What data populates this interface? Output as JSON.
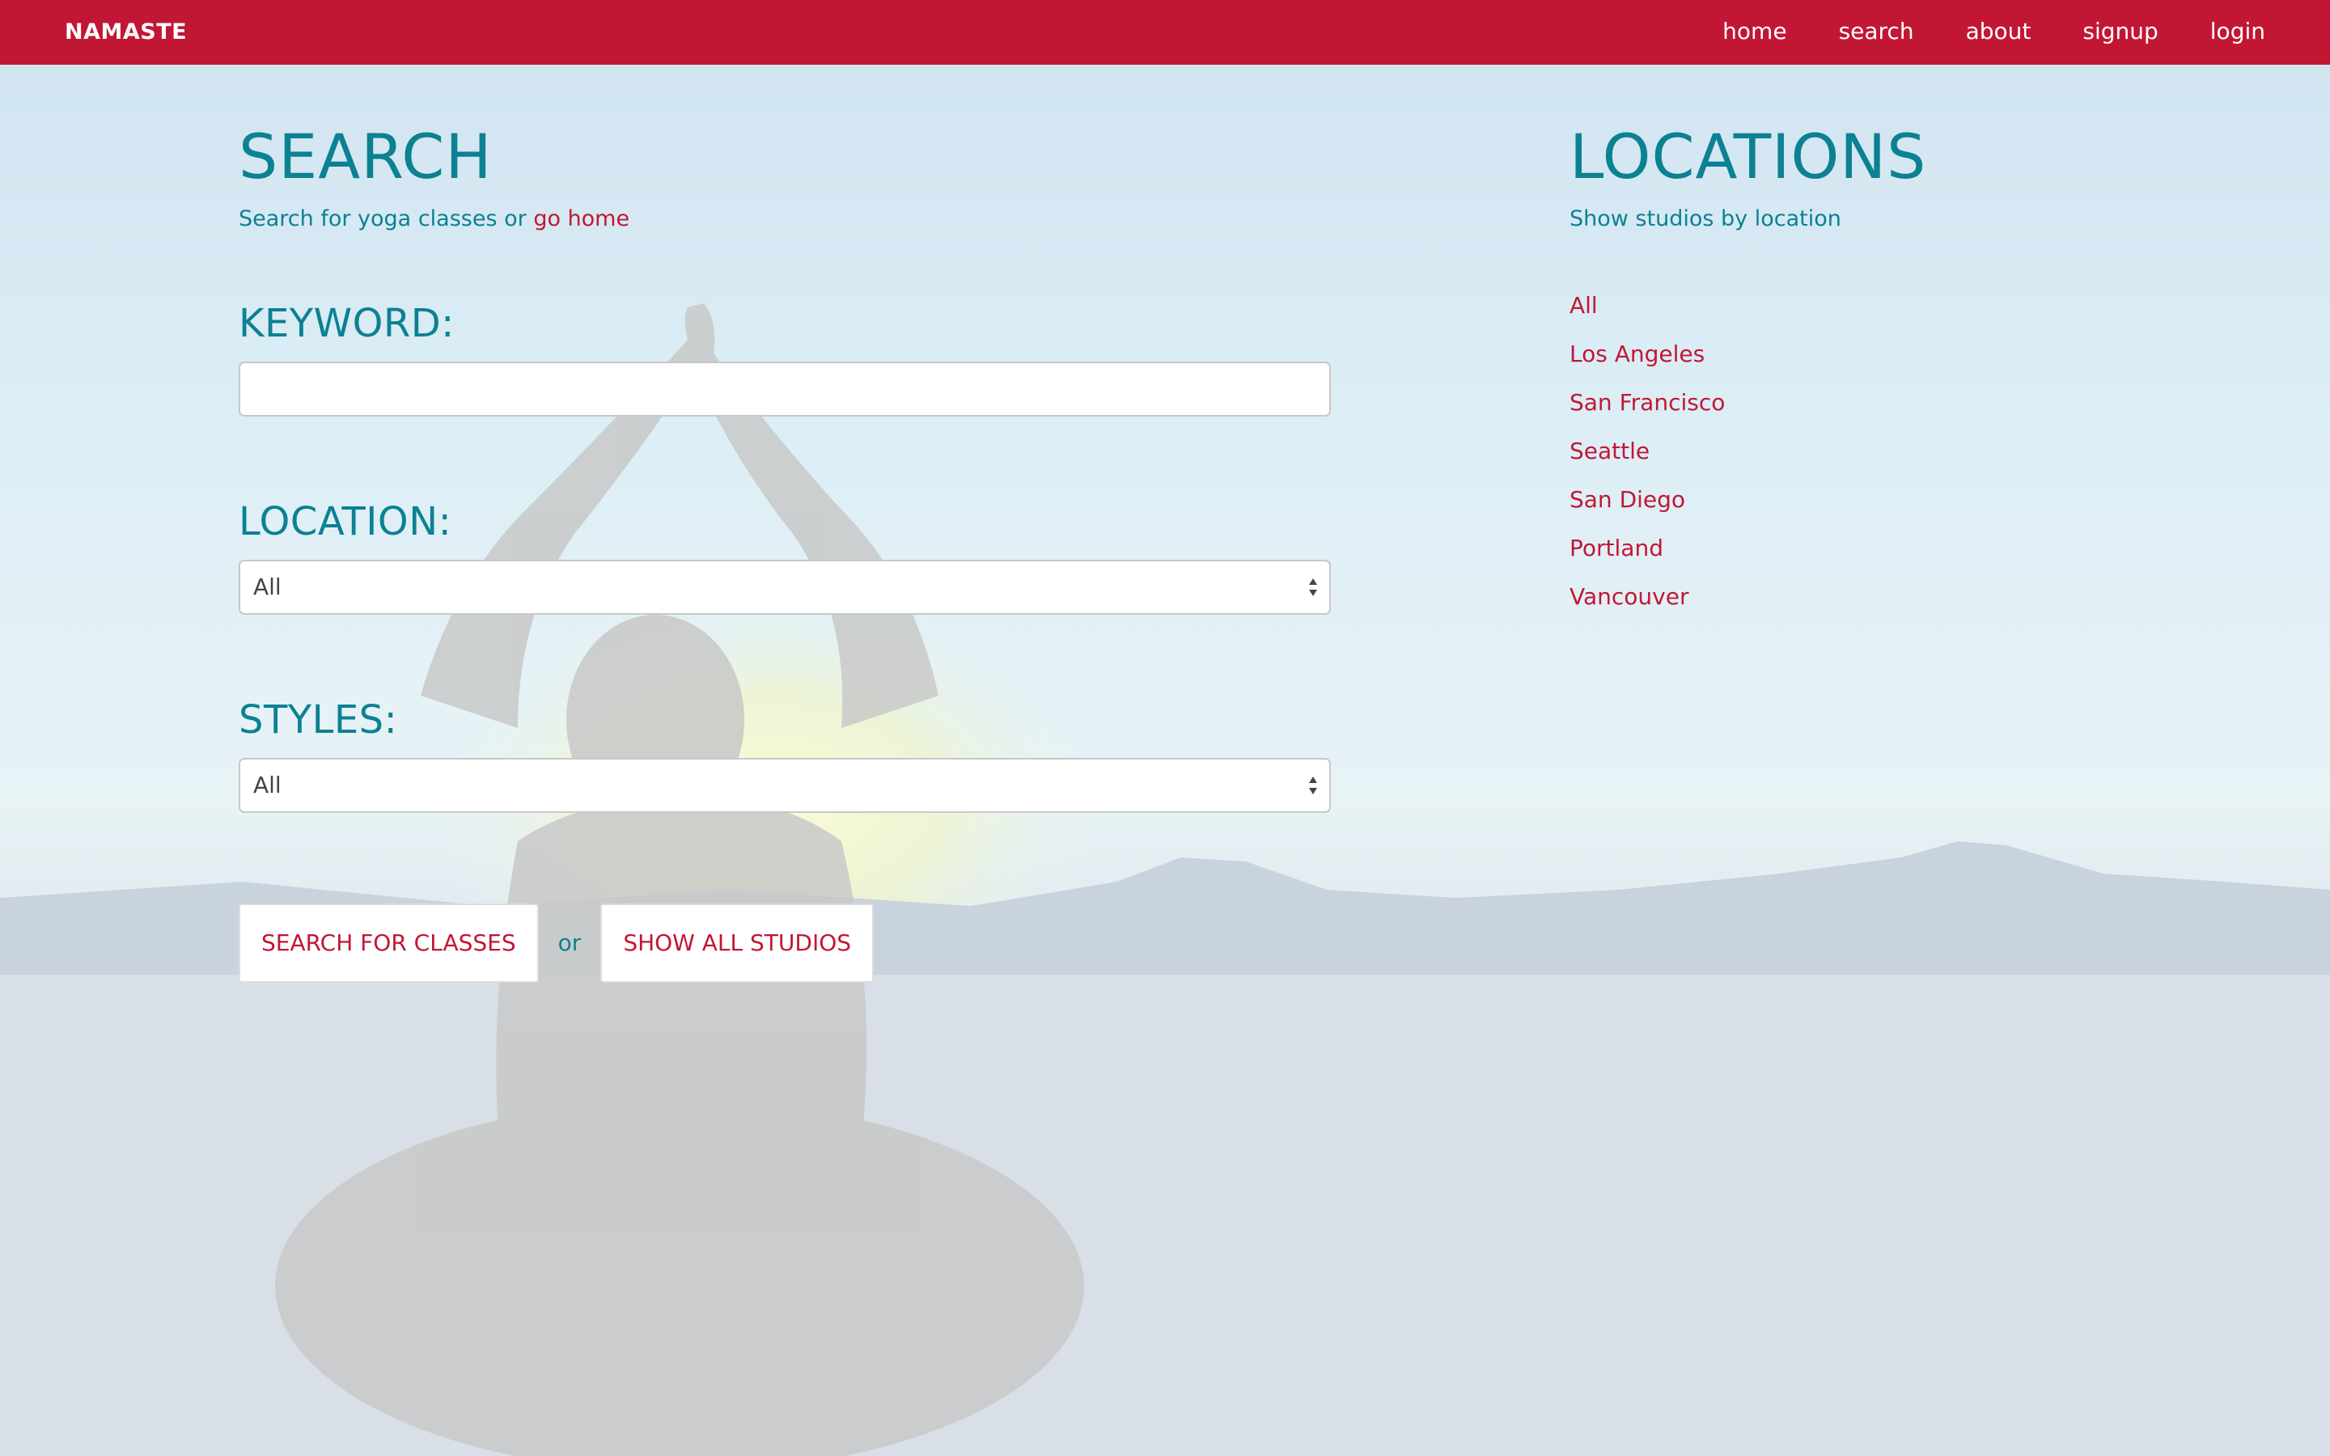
{
  "navbar": {
    "brand": "NAMASTE",
    "links": [
      "home",
      "search",
      "about",
      "signup",
      "login"
    ]
  },
  "search": {
    "title": "SEARCH",
    "subtitle_text": "Search for yoga classes or ",
    "subtitle_link": "go home",
    "keyword_label": "KEYWORD:",
    "keyword_value": "",
    "location_label": "LOCATION:",
    "location_selected": "All",
    "styles_label": "STYLES:",
    "styles_selected": "All",
    "search_button": "SEARCH FOR CLASSES",
    "or_text": "or",
    "show_all_button": "SHOW ALL STUDIOS"
  },
  "locations": {
    "title": "LOCATIONS",
    "subtitle": "Show studios by location",
    "items": [
      "All",
      "Los Angeles",
      "San Francisco",
      "Seattle",
      "San Diego",
      "Portland",
      "Vancouver"
    ]
  },
  "colors": {
    "brand_red": "#c21734",
    "teal": "#0b8192"
  },
  "icons": {
    "select_arrows": "select-arrows-icon"
  }
}
